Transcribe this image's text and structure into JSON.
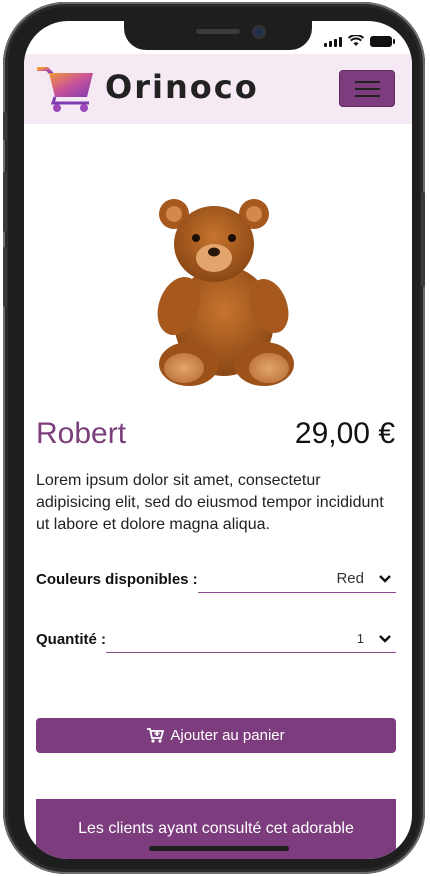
{
  "header": {
    "brand": "Orinoco",
    "logo_icon": "shopping-cart-icon",
    "menu_icon": "hamburger-menu-icon"
  },
  "product": {
    "name": "Robert",
    "price": "29,00 €",
    "description": "Lorem ipsum dolor sit amet, consectetur adipisicing elit, sed do eiusmod tempor incididunt ut labore et dolore magna aliqua.",
    "image": "teddy-bear-photo"
  },
  "options": {
    "colors_label": "Couleurs disponibles :",
    "color_value": "Red",
    "quantity_label": "Quantité :",
    "quantity_value": "1"
  },
  "actions": {
    "add_to_cart": "Ajouter au panier"
  },
  "promo": {
    "text": "Les clients ayant consulté cet adorable"
  },
  "colors": {
    "accent": "#7d3c7e",
    "header_bg": "#f5eaf4",
    "name_color": "#7b3f7c"
  }
}
